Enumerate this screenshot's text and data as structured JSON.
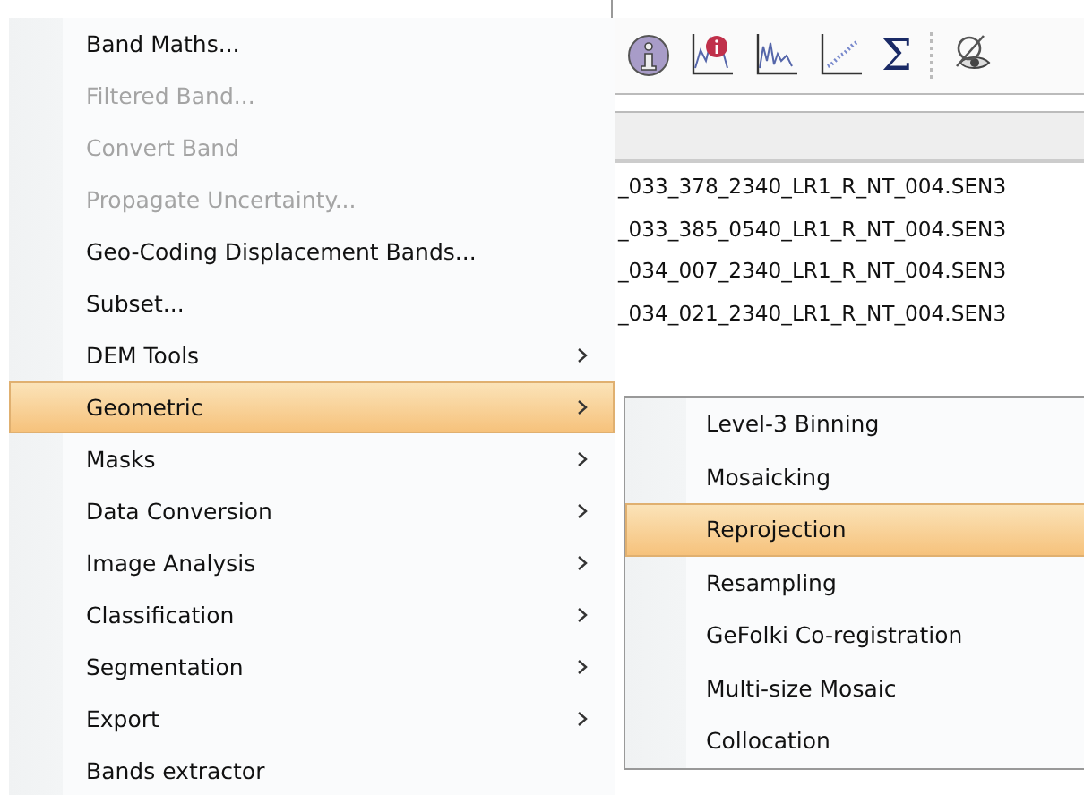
{
  "toolbar": {
    "sum_symbol": "Σ"
  },
  "file_list": [
    "_033_378_2340_LR1_R_NT_004.SEN3",
    "_033_385_0540_LR1_R_NT_004.SEN3",
    "_034_007_2340_LR1_R_NT_004.SEN3",
    "_034_021_2340_LR1_R_NT_004.SEN3"
  ],
  "menu": [
    {
      "label": "Band Maths...",
      "disabled": false,
      "submenu": false,
      "selected": false
    },
    {
      "label": "Filtered Band...",
      "disabled": true,
      "submenu": false,
      "selected": false
    },
    {
      "label": "Convert Band",
      "disabled": true,
      "submenu": false,
      "selected": false
    },
    {
      "label": "Propagate Uncertainty...",
      "disabled": true,
      "submenu": false,
      "selected": false
    },
    {
      "label": "Geo-Coding Displacement Bands...",
      "disabled": false,
      "submenu": false,
      "selected": false
    },
    {
      "label": "Subset...",
      "disabled": false,
      "submenu": false,
      "selected": false
    },
    {
      "label": "DEM Tools",
      "disabled": false,
      "submenu": true,
      "selected": false
    },
    {
      "label": "Geometric",
      "disabled": false,
      "submenu": true,
      "selected": true
    },
    {
      "label": "Masks",
      "disabled": false,
      "submenu": true,
      "selected": false
    },
    {
      "label": "Data Conversion",
      "disabled": false,
      "submenu": true,
      "selected": false
    },
    {
      "label": "Image Analysis",
      "disabled": false,
      "submenu": true,
      "selected": false
    },
    {
      "label": "Classification",
      "disabled": false,
      "submenu": true,
      "selected": false
    },
    {
      "label": "Segmentation",
      "disabled": false,
      "submenu": true,
      "selected": false
    },
    {
      "label": "Export",
      "disabled": false,
      "submenu": true,
      "selected": false
    },
    {
      "label": "Bands extractor",
      "disabled": false,
      "submenu": false,
      "selected": false
    }
  ],
  "submenu": [
    {
      "label": "Level-3 Binning",
      "selected": false
    },
    {
      "label": "Mosaicking",
      "selected": false
    },
    {
      "label": "Reprojection",
      "selected": true
    },
    {
      "label": "Resampling",
      "selected": false
    },
    {
      "label": "GeFolki Co-registration",
      "selected": false
    },
    {
      "label": "Multi-size Mosaic",
      "selected": false
    },
    {
      "label": "Collocation",
      "selected": false
    }
  ]
}
